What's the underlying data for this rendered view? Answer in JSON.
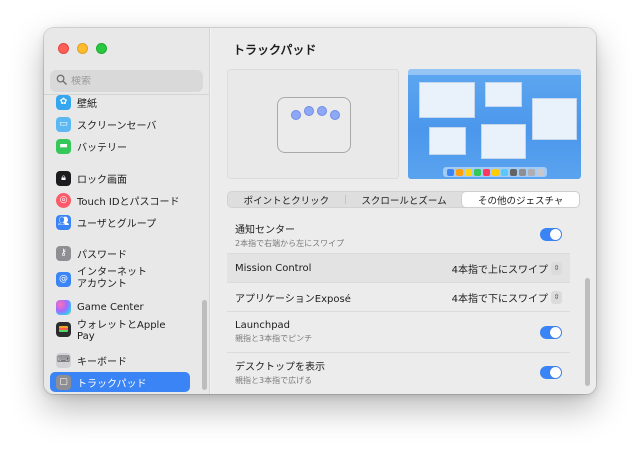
{
  "window": {
    "title": "トラックパッド"
  },
  "search": {
    "placeholder": "検索"
  },
  "sidebar": {
    "items": [
      {
        "label": "壁紙",
        "icon": "wallpaper-icon",
        "color": "#34a7f0"
      },
      {
        "label": "スクリーンセーバ",
        "icon": "screensaver-icon",
        "color": "#5bb8f2"
      },
      {
        "label": "バッテリー",
        "icon": "battery-icon",
        "color": "#34c759"
      },
      {
        "label": "ロック画面",
        "icon": "lock-icon",
        "color": "#1c1c1e"
      },
      {
        "label": "Touch IDとパスコード",
        "icon": "fingerprint-icon",
        "color": "#ff5a6a"
      },
      {
        "label": "ユーザとグループ",
        "icon": "users-icon",
        "color": "#3a84f5"
      },
      {
        "label": "パスワード",
        "icon": "key-icon",
        "color": "#8e8e93"
      },
      {
        "label": "インターネット\nアカウント",
        "icon": "at-icon",
        "color": "#3a84f5"
      },
      {
        "label": "Game Center",
        "icon": "game-center-icon",
        "color": "#e2e2e2"
      },
      {
        "label": "ウォレットとApple Pay",
        "icon": "wallet-icon",
        "color": "#2c2c2e"
      },
      {
        "label": "キーボード",
        "icon": "keyboard-icon",
        "color": "#c7c7cc"
      },
      {
        "label": "トラックパッド",
        "icon": "trackpad-icon",
        "color": "#8e8e93",
        "selected": true
      }
    ]
  },
  "tabs": [
    {
      "label": "ポイントとクリック"
    },
    {
      "label": "スクロールとズーム"
    },
    {
      "label": "その他のジェスチャ",
      "active": true
    }
  ],
  "settings": [
    {
      "label": "通知センター",
      "sub": "2本指で右端から左にスワイプ",
      "control": "toggle",
      "on": true
    },
    {
      "label": "Mission Control",
      "control": "popup",
      "value": "4本指で上にスワイプ"
    },
    {
      "label": "アプリケーションExposé",
      "control": "popup",
      "value": "4本指で下にスワイプ"
    },
    {
      "label": "Launchpad",
      "sub": "親指と3本指でピンチ",
      "control": "toggle",
      "on": true
    },
    {
      "label": "デスクトップを表示",
      "sub": "親指と3本指で広げる",
      "control": "toggle",
      "on": true
    }
  ],
  "colors": {
    "accent": "#3a84f5",
    "close": "#ff5f57",
    "minimize": "#febc2e",
    "zoom": "#28c840"
  }
}
